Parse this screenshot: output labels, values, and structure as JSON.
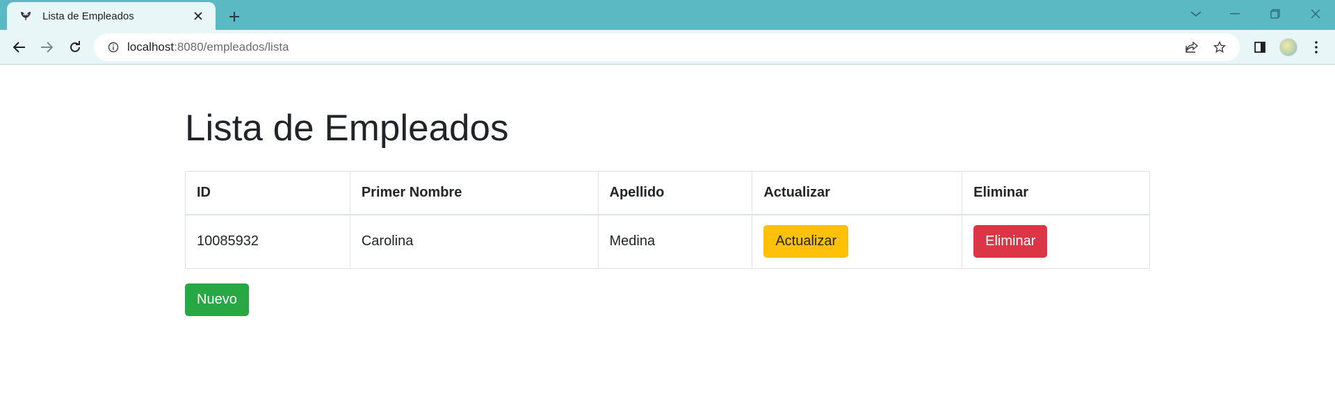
{
  "browser": {
    "tab": {
      "title": "Lista de Empleados",
      "favicon": "spring-logo-icon"
    },
    "url": {
      "host": "localhost",
      "rest": ":8080/empleados/lista"
    },
    "colors": {
      "tabstrip": "#5ab9c3",
      "toolbar": "#e9f6f8"
    }
  },
  "page": {
    "title": "Lista de Empleados",
    "table": {
      "headers": [
        "ID",
        "Primer Nombre",
        "Apellido",
        "Actualizar",
        "Eliminar"
      ],
      "rows": [
        {
          "id": "10085932",
          "nombre": "Carolina",
          "apellido": "Medina",
          "actualizar_label": "Actualizar",
          "eliminar_label": "Eliminar"
        }
      ]
    },
    "nuevo_label": "Nuevo",
    "colors": {
      "warning": "#ffc107",
      "danger": "#dc3545",
      "success": "#28a745"
    }
  }
}
